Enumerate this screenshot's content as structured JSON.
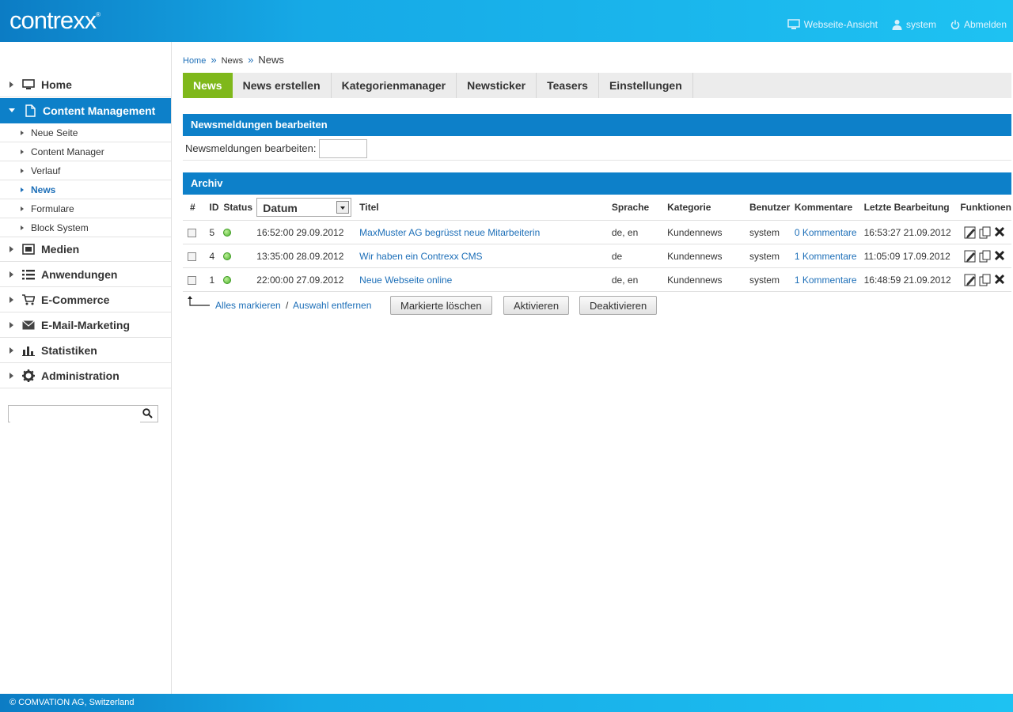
{
  "header": {
    "logo": "contrexx",
    "logo_mark": "®",
    "links": [
      {
        "label": "Webseite-Ansicht",
        "icon": "monitor-icon"
      },
      {
        "label": "system",
        "icon": "user-icon"
      },
      {
        "label": "Abmelden",
        "icon": "power-icon"
      }
    ]
  },
  "sidebar": {
    "items": [
      {
        "label": "Home",
        "icon": "monitor-icon"
      },
      {
        "label": "Content Management",
        "icon": "page-icon",
        "active": true
      },
      {
        "label": "Medien",
        "icon": "media-icon"
      },
      {
        "label": "Anwendungen",
        "icon": "list-icon"
      },
      {
        "label": "E-Commerce",
        "icon": "cart-icon"
      },
      {
        "label": "E-Mail-Marketing",
        "icon": "envelope-icon"
      },
      {
        "label": "Statistiken",
        "icon": "bar-chart-icon"
      },
      {
        "label": "Administration",
        "icon": "gear-icon"
      }
    ],
    "subitems": [
      {
        "label": "Neue Seite"
      },
      {
        "label": "Content Manager"
      },
      {
        "label": "Verlauf"
      },
      {
        "label": "News",
        "active": true
      },
      {
        "label": "Formulare"
      },
      {
        "label": "Block System"
      }
    ],
    "search_placeholder": ""
  },
  "breadcrumb": [
    "Home",
    "News",
    "News"
  ],
  "tabs": [
    {
      "label": "News",
      "active": true
    },
    {
      "label": "News erstellen"
    },
    {
      "label": "Kategorienmanager"
    },
    {
      "label": "Newsticker"
    },
    {
      "label": "Teasers"
    },
    {
      "label": "Einstellungen"
    }
  ],
  "edit_section": {
    "title": "Newsmeldungen bearbeiten",
    "label": "Newsmeldungen bearbeiten:",
    "value": ""
  },
  "archive": {
    "title": "Archiv",
    "columns": [
      "#",
      "ID",
      "Status",
      "Datum",
      "Titel",
      "Sprache",
      "Kategorie",
      "Benutzer",
      "Kommentare",
      "Letzte Bearbeitung",
      "Funktionen"
    ],
    "rows": [
      {
        "id": "5",
        "status": "active",
        "date": "16:52:00 29.09.2012",
        "title": "MaxMuster AG begrüsst neue Mitarbeiterin",
        "language": "de, en",
        "category": "Kundennews",
        "user": "system",
        "comments": "0 Kommentare",
        "last_edit": "16:53:27 21.09.2012"
      },
      {
        "id": "4",
        "status": "active",
        "date": "13:35:00 28.09.2012",
        "title": "Wir haben ein Contrexx CMS",
        "language": "de",
        "category": "Kundennews",
        "user": "system",
        "comments": "1 Kommentare",
        "last_edit": "11:05:09 17.09.2012"
      },
      {
        "id": "1",
        "status": "active",
        "date": "22:00:00 27.09.2012",
        "title": "Neue Webseite online",
        "language": "de, en",
        "category": "Kundennews",
        "user": "system",
        "comments": "1 Kommentare",
        "last_edit": "16:48:59 21.09.2012"
      }
    ],
    "select_all": "Alles markieren",
    "separator": "/",
    "deselect": "Auswahl entfernen",
    "buttons": [
      "Markierte löschen",
      "Aktivieren",
      "Deaktivieren"
    ]
  },
  "footer": "© COMVATION AG, Switzerland",
  "colors": {
    "accent": "#0d80c9",
    "active_tab": "#7fb81b",
    "link": "#1d6fb8",
    "status_active": "#4db32e"
  }
}
